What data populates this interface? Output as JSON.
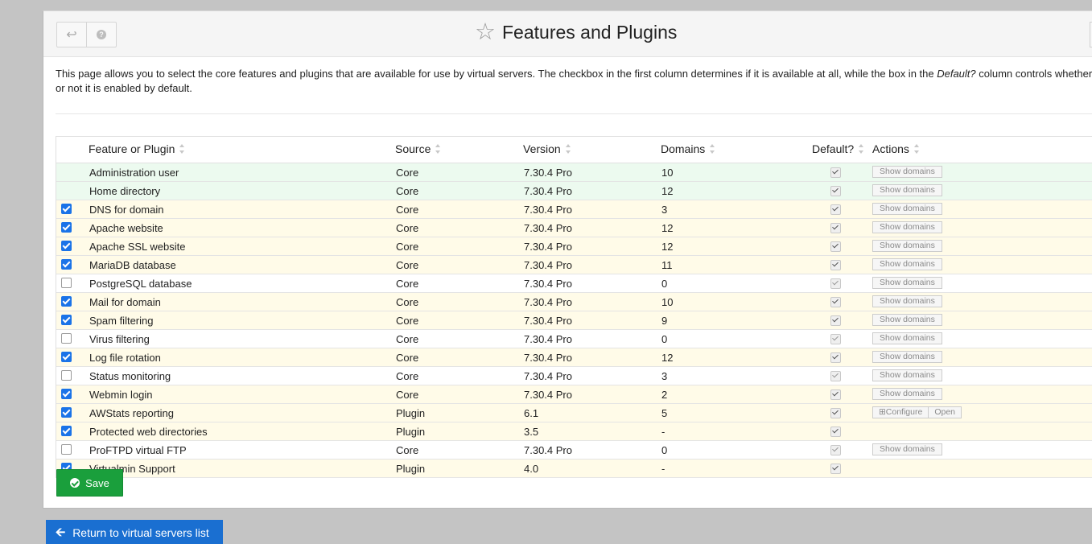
{
  "header": {
    "title": "Features and Plugins",
    "back_icon": "undo-arrow-icon",
    "help_icon": "question-circle-icon",
    "star_icon": "star-outline-icon"
  },
  "description": {
    "part1": "This page allows you to select the core features and plugins that are available for use by virtual servers. The checkbox in the first column determines if it is available at all, while the box in the ",
    "emph": "Default?",
    "part2": " column controls whether or not it is enabled by default."
  },
  "table": {
    "columns": [
      "Feature or Plugin",
      "Source",
      "Version",
      "Domains",
      "Default?",
      "Actions"
    ],
    "rows": [
      {
        "enabled": null,
        "feature": "Administration user",
        "source": "Core",
        "version": "7.30.4 Pro",
        "domains": "10",
        "default": true,
        "actions": [
          "Show domains"
        ],
        "style": "green"
      },
      {
        "enabled": null,
        "feature": "Home directory",
        "source": "Core",
        "version": "7.30.4 Pro",
        "domains": "12",
        "default": true,
        "actions": [
          "Show domains"
        ],
        "style": "green"
      },
      {
        "enabled": true,
        "feature": "DNS for domain",
        "source": "Core",
        "version": "7.30.4 Pro",
        "domains": "3",
        "default": true,
        "actions": [
          "Show domains"
        ],
        "style": "yellow"
      },
      {
        "enabled": true,
        "feature": "Apache website",
        "source": "Core",
        "version": "7.30.4 Pro",
        "domains": "12",
        "default": true,
        "actions": [
          "Show domains"
        ],
        "style": "yellow"
      },
      {
        "enabled": true,
        "feature": "Apache SSL website",
        "source": "Core",
        "version": "7.30.4 Pro",
        "domains": "12",
        "default": true,
        "actions": [
          "Show domains"
        ],
        "style": "yellow"
      },
      {
        "enabled": true,
        "feature": "MariaDB database",
        "source": "Core",
        "version": "7.30.4 Pro",
        "domains": "11",
        "default": true,
        "actions": [
          "Show domains"
        ],
        "style": "yellow"
      },
      {
        "enabled": false,
        "feature": "PostgreSQL database",
        "source": "Core",
        "version": "7.30.4 Pro",
        "domains": "0",
        "default": true,
        "actions": [
          "Show domains"
        ],
        "style": "white"
      },
      {
        "enabled": true,
        "feature": "Mail for domain",
        "source": "Core",
        "version": "7.30.4 Pro",
        "domains": "10",
        "default": true,
        "actions": [
          "Show domains"
        ],
        "style": "yellow"
      },
      {
        "enabled": true,
        "feature": "Spam filtering",
        "source": "Core",
        "version": "7.30.4 Pro",
        "domains": "9",
        "default": true,
        "actions": [
          "Show domains"
        ],
        "style": "yellow"
      },
      {
        "enabled": false,
        "feature": "Virus filtering",
        "source": "Core",
        "version": "7.30.4 Pro",
        "domains": "0",
        "default": true,
        "actions": [
          "Show domains"
        ],
        "style": "white"
      },
      {
        "enabled": true,
        "feature": "Log file rotation",
        "source": "Core",
        "version": "7.30.4 Pro",
        "domains": "12",
        "default": true,
        "actions": [
          "Show domains"
        ],
        "style": "yellow"
      },
      {
        "enabled": false,
        "feature": "Status monitoring",
        "source": "Core",
        "version": "7.30.4 Pro",
        "domains": "3",
        "default": true,
        "actions": [
          "Show domains"
        ],
        "style": "white"
      },
      {
        "enabled": true,
        "feature": "Webmin login",
        "source": "Core",
        "version": "7.30.4 Pro",
        "domains": "2",
        "default": true,
        "actions": [
          "Show domains"
        ],
        "style": "yellow"
      },
      {
        "enabled": true,
        "feature": "AWStats reporting",
        "source": "Plugin",
        "version": "6.1",
        "domains": "5",
        "default": true,
        "actions": [
          "⊞Configure",
          "Open"
        ],
        "style": "yellow"
      },
      {
        "enabled": true,
        "feature": "Protected web directories",
        "source": "Plugin",
        "version": "3.5",
        "domains": "-",
        "default": true,
        "actions": [],
        "style": "yellow"
      },
      {
        "enabled": false,
        "feature": "ProFTPD virtual FTP",
        "source": "Core",
        "version": "7.30.4 Pro",
        "domains": "0",
        "default": true,
        "actions": [
          "Show domains"
        ],
        "style": "white"
      },
      {
        "enabled": true,
        "feature": "Virtualmin Support",
        "source": "Plugin",
        "version": "4.0",
        "domains": "-",
        "default": true,
        "actions": [],
        "style": "yellow"
      }
    ]
  },
  "buttons": {
    "save": "Save",
    "return": "Return to virtual servers list"
  },
  "colors": {
    "save_green": "#1a9f3c",
    "return_blue": "#1a6fd1",
    "checkbox_blue": "#1a73e8",
    "row_enabled": "#fffbe8",
    "row_always": "#ecfaef"
  }
}
